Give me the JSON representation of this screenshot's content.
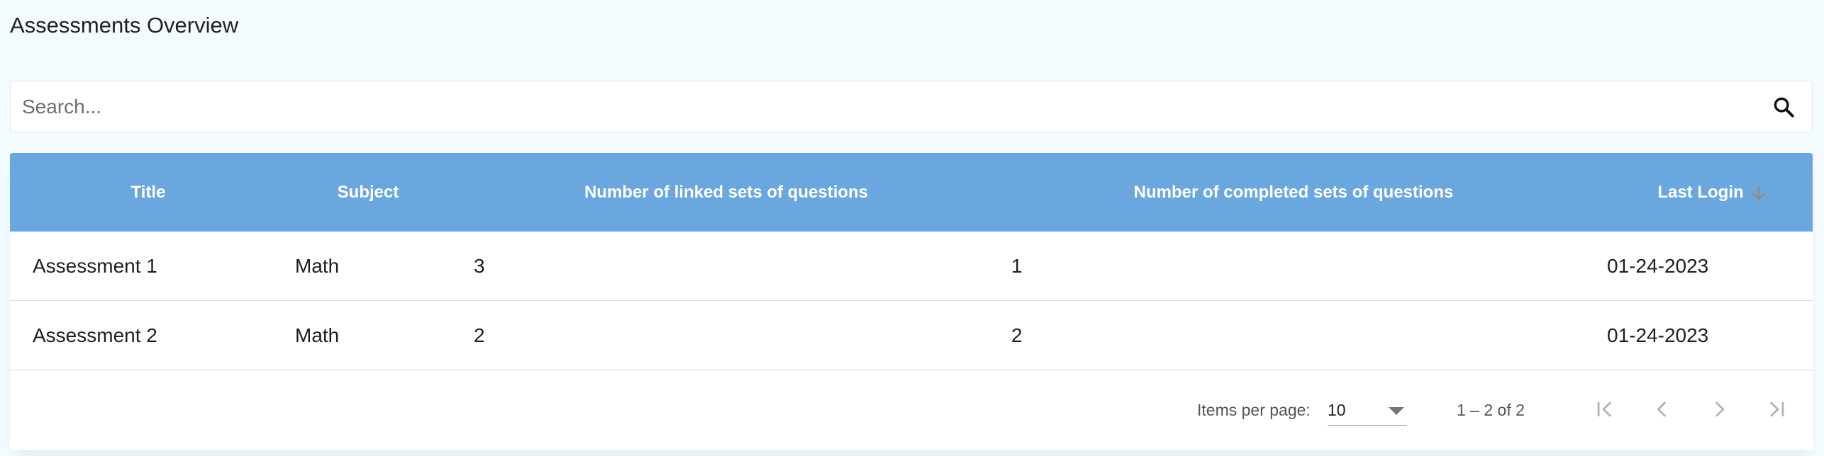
{
  "page": {
    "title": "Assessments Overview"
  },
  "search": {
    "placeholder": "Search...",
    "value": ""
  },
  "table": {
    "columns": [
      "Title",
      "Subject",
      "Number of linked sets of questions",
      "Number of completed sets of questions",
      "Last Login"
    ],
    "sort_icon": "arrow-down-icon",
    "rows": [
      {
        "title": "Assessment 1",
        "subject": "Math",
        "linked": "3",
        "completed": "1",
        "last_login": "01-24-2023"
      },
      {
        "title": "Assessment 2",
        "subject": "Math",
        "linked": "2",
        "completed": "2",
        "last_login": "01-24-2023"
      }
    ]
  },
  "paginator": {
    "items_per_page_label": "Items per page:",
    "page_size": "10",
    "range_label": "1 – 2 of 2"
  },
  "colors": {
    "header_bg": "#6aa7de",
    "page_bg": "#f3fbfe",
    "header_text": "#ffffff"
  }
}
